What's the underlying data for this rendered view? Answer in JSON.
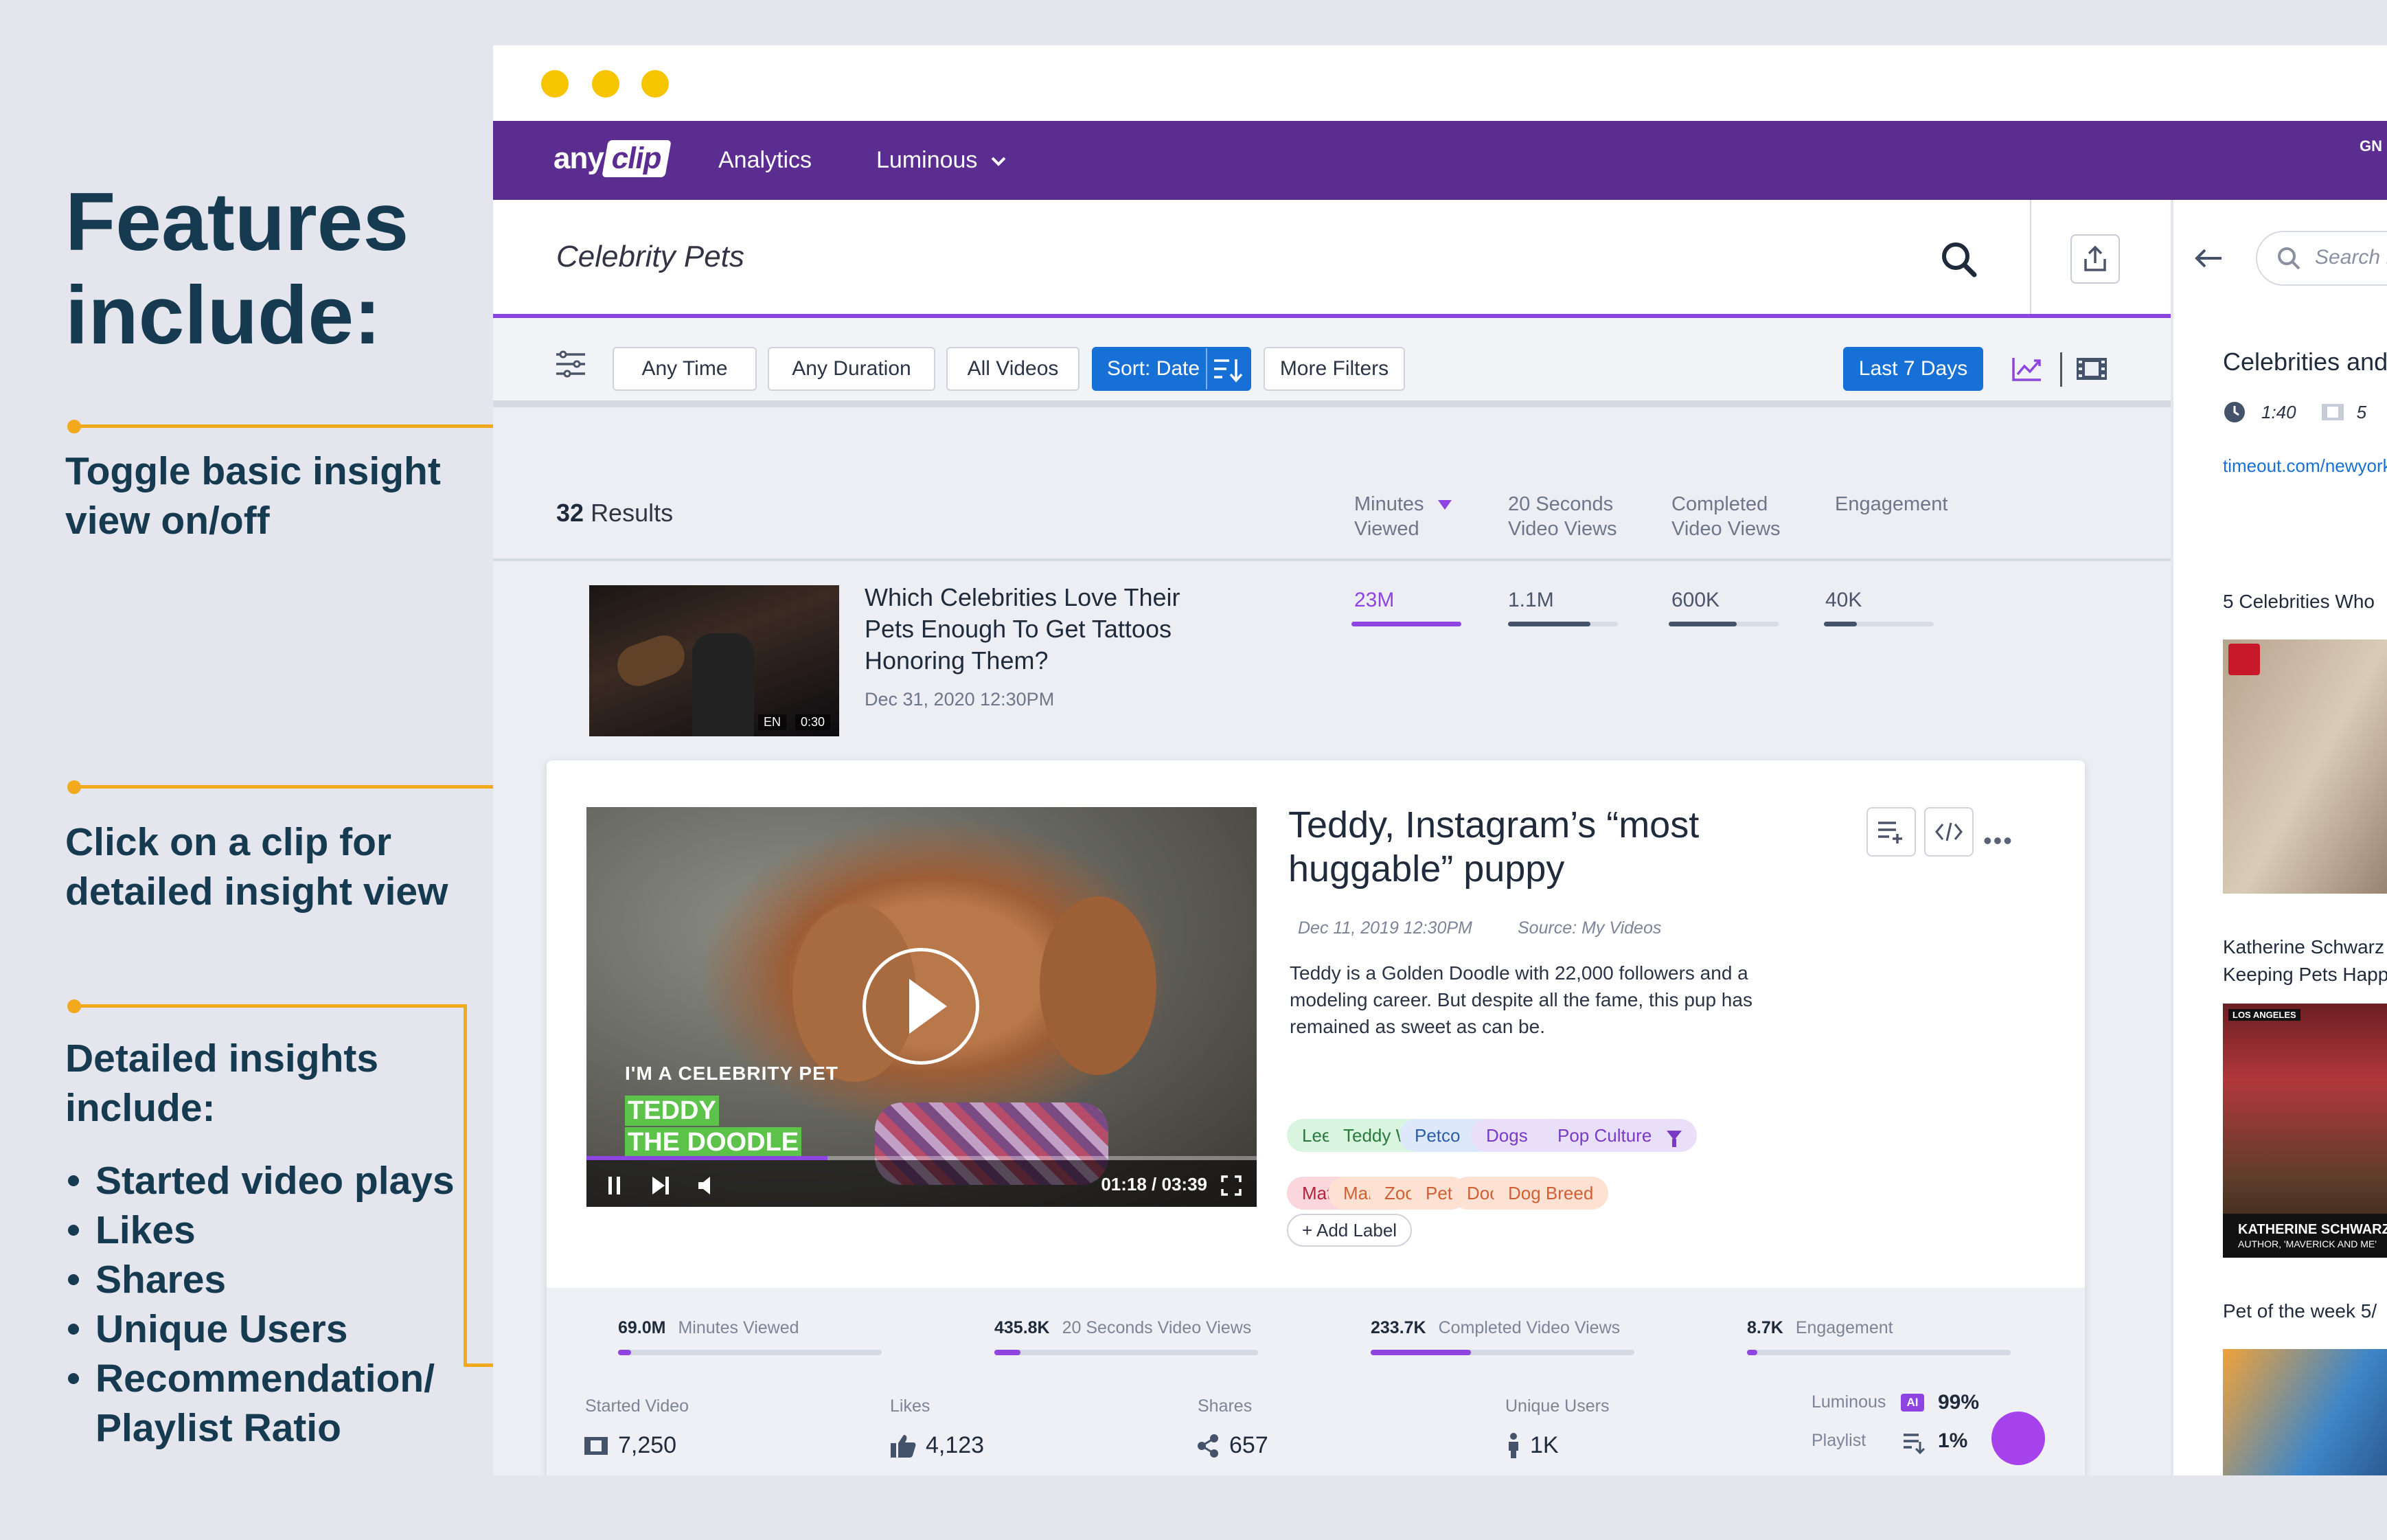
{
  "annotations": {
    "title": "Features include:",
    "toggle": [
      "Toggle basic insight",
      "view on/off"
    ],
    "click": [
      "Click on a clip for",
      "detailed insight view"
    ],
    "detailed": [
      "Detailed insights",
      "include:"
    ],
    "list": [
      "Started video plays",
      "Likes",
      "Shares",
      "Unique Users",
      "Recommendation/",
      "Playlist Ratio"
    ]
  },
  "nav": {
    "logo_any": "any",
    "logo_clip": "clip",
    "links": [
      "Analytics",
      "Luminous"
    ],
    "user": "GN"
  },
  "search": {
    "query": "Celebrity Pets"
  },
  "filters": {
    "chips": [
      "Any Time",
      "Any Duration",
      "All Videos",
      "Sort: Date",
      "More Filters"
    ],
    "range": "Last 7 Days"
  },
  "results": {
    "count": "32",
    "label": "Results",
    "columns": [
      [
        "Minutes",
        "Viewed"
      ],
      [
        "20 Seconds",
        "Video Views"
      ],
      [
        "Completed",
        "Video Views"
      ],
      [
        "Engagement",
        ""
      ]
    ]
  },
  "video1": {
    "title": "Which Celebrities Love Their Pets Enough To Get Tattoos Honoring Them?",
    "date": "Dec 31, 2020 12:30PM",
    "lang": "EN",
    "duration": "0:30",
    "metrics": [
      {
        "value": "23M",
        "fill": 1.0
      },
      {
        "value": "1.1M",
        "fill": 0.75
      },
      {
        "value": "600K",
        "fill": 0.62
      },
      {
        "value": "40K",
        "fill": 0.3
      }
    ]
  },
  "detail": {
    "title": "Teddy, Instagram’s “most huggable” puppy",
    "date": "Dec 11, 2019 12:30PM",
    "source": "Source: My Videos",
    "description": "Teddy is a Golden Doodle with 22,000 followers and a modeling career. But despite all the fame, this pup has remained as sweet as can be.",
    "player": {
      "brand_line": "I'M A CELEBRITY PET",
      "name1": "TEDDY",
      "name2": "THE DOODLE",
      "time": "01:18 / 03:39",
      "progress": 0.36
    },
    "tags_row1": [
      {
        "label": "Leelee Sobieski",
        "color": "g",
        "filter": false
      },
      {
        "label": "Teddy Woof",
        "color": "g",
        "filter": true
      },
      {
        "label": "Petco",
        "color": "b",
        "filter": true
      },
      {
        "label": "Dogs",
        "color": "v",
        "filter": true
      },
      {
        "label": "Pop Culture",
        "color": "v",
        "filter": true
      }
    ],
    "tags_row2": [
      {
        "label": "Mature Suggestion",
        "color": "r"
      },
      {
        "label": "Mammal",
        "color": "o"
      },
      {
        "label": "Zoomin",
        "color": "o"
      },
      {
        "label": "Pet",
        "color": "o"
      },
      {
        "label": "Doodle",
        "color": "o"
      },
      {
        "label": "Dog Breed",
        "color": "o"
      }
    ],
    "add_label": "+ Add Label",
    "top_stats": [
      {
        "value": "69.0M",
        "label": "Minutes Viewed",
        "fill": 0.05
      },
      {
        "value": "435.8K",
        "label": "20 Seconds Video Views",
        "fill": 0.1
      },
      {
        "value": "233.7K",
        "label": "Completed Video Views",
        "fill": 0.38
      },
      {
        "value": "8.7K",
        "label": "Engagement",
        "fill": 0.04
      }
    ],
    "bottom_stats": [
      {
        "label": "Started Video",
        "value": "7,250"
      },
      {
        "label": "Likes",
        "value": "4,123"
      },
      {
        "label": "Shares",
        "value": "657"
      },
      {
        "label": "Unique Users",
        "value": "1K"
      }
    ],
    "luminous": {
      "label1": "Luminous",
      "ai": "AI",
      "val1": "99%",
      "label2": "Playlist",
      "val2": "1%"
    }
  },
  "right_panel": {
    "search_placeholder": "Search Pages",
    "title": "Celebrities and",
    "duration": "1:40",
    "count": "5",
    "link": "timeout.com/newyork",
    "items": [
      "5 Celebrities Who",
      "Katherine Schwarz",
      "Keeping Pets Happ",
      "Pet of the week 5/"
    ],
    "thumb_caption1": "KATHERINE SCHWARZ",
    "thumb_caption2": "AUTHOR, 'MAVERICK AND ME'",
    "thumb_tag": "LOS ANGELES"
  },
  "colors": {
    "accent": "#8e44e0",
    "nav": "#5c2d91",
    "blue": "#1670d6",
    "orange": "#f2a91c",
    "heading": "#163a4f"
  }
}
